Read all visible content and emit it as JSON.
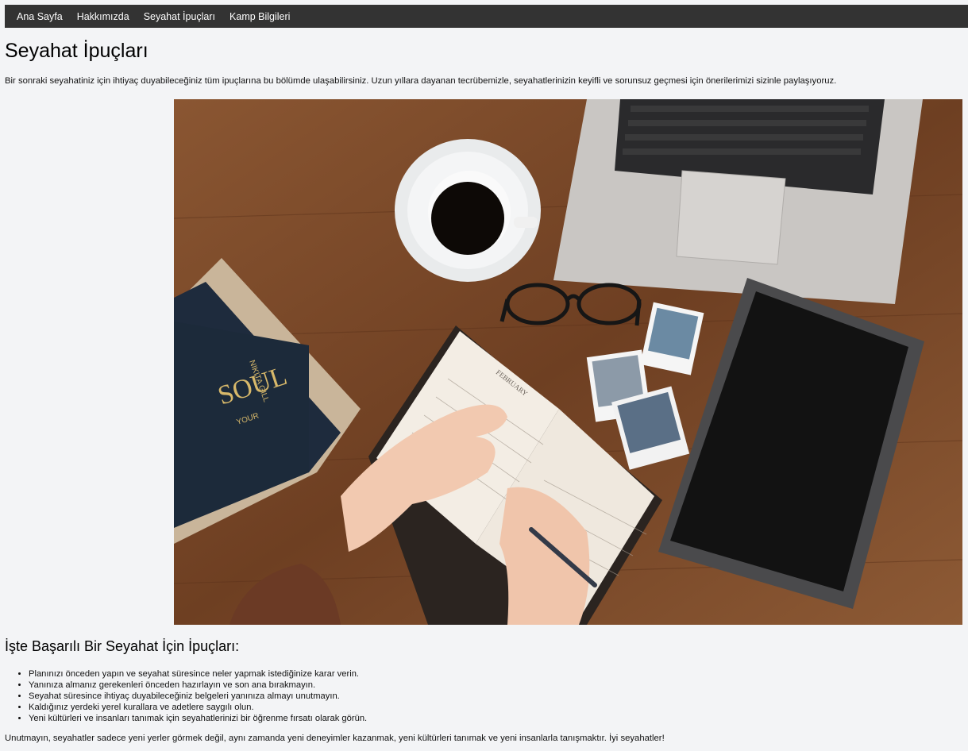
{
  "nav": {
    "items": [
      {
        "label": "Ana Sayfa"
      },
      {
        "label": "Hakkımızda"
      },
      {
        "label": "Seyahat İpuçları"
      },
      {
        "label": "Kamp Bilgileri"
      }
    ]
  },
  "page": {
    "title": "Seyahat İpuçları",
    "intro": "Bir sonraki seyahatiniz için ihtiyaç duyabileceğiniz tüm ipuçlarına bu bölümde ulaşabilirsiniz. Uzun yıllara dayanan tecrübemizle, seyahatlerinizin keyifli ve sorunsuz geçmesi için önerilerimizi sizinle paylaşıyoruz."
  },
  "hero": {
    "book_title": "SOUL",
    "book_subtitle": "YOUR",
    "book_author": "NIKITA GILL",
    "planner_month": "FEBRUARY"
  },
  "tips": {
    "heading": "İşte Başarılı Bir Seyahat İçin İpuçları:",
    "items": [
      "Planınızı önceden yapın ve seyahat süresince neler yapmak istediğinize karar verin.",
      "Yanınıza almanız gerekenleri önceden hazırlayın ve son ana bırakmayın.",
      "Seyahat süresince ihtiyaç duyabileceğiniz belgeleri yanınıza almayı unutmayın.",
      "Kaldığınız yerdeki yerel kurallara ve adetlere saygılı olun.",
      "Yeni kültürleri ve insanları tanımak için seyahatlerinizi bir öğrenme fırsatı olarak görün."
    ]
  },
  "outro": "Unutmayın, seyahatler sadece yeni yerler görmek değil, aynı zamanda yeni deneyimler kazanmak, yeni kültürleri tanımak ve yeni insanlarla tanışmaktır. İyi seyahatler!"
}
